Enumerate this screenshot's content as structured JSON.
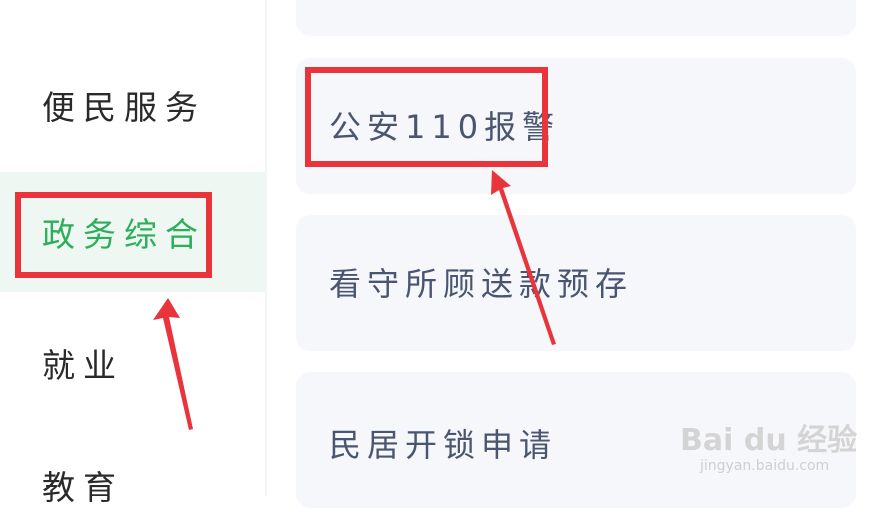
{
  "sidebar": {
    "items": [
      {
        "label": "便民服务",
        "active": false
      },
      {
        "label": "政务综合",
        "active": true
      },
      {
        "label": "就业",
        "active": false
      },
      {
        "label": "教育",
        "active": false
      }
    ]
  },
  "services": [
    {
      "label": ""
    },
    {
      "label": "公安110报警"
    },
    {
      "label": "看守所顾送款预存"
    },
    {
      "label": "民居开锁申请"
    }
  ],
  "watermark": {
    "logo": "Bai du 经验",
    "url": "jingyan.baidu.com"
  },
  "colors": {
    "accent_green": "#2dae5b",
    "highlight_red": "#e8343a",
    "card_bg": "#f6f7fa",
    "active_bg": "#eef7f1"
  }
}
